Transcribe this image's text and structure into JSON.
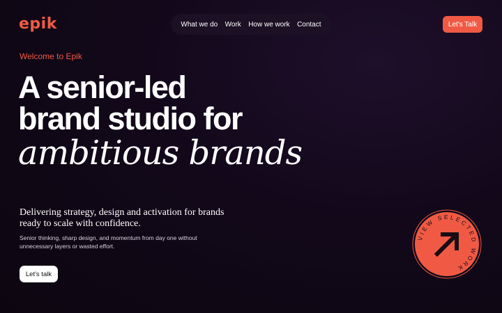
{
  "brand": {
    "logo_text": "epik",
    "accent": "#f05a44"
  },
  "nav": {
    "items": [
      {
        "label": "What we do"
      },
      {
        "label": "Work"
      },
      {
        "label": "How we work"
      },
      {
        "label": "Contact"
      }
    ]
  },
  "header": {
    "cta_label": "Let's Talk"
  },
  "hero": {
    "eyebrow": "Welcome to Epik",
    "headline_line1": "A senior-led",
    "headline_line2": "brand studio for",
    "headline_line3": "ambitious brands",
    "subhead": "Delivering strategy, design and activation for brands ready to scale with confidence.",
    "body": "Senior thinking, sharp design, and momentum from day one without unnecessary layers or wasted effort.",
    "cta_label": "Let's talk"
  },
  "badge": {
    "ring_text": "VIEW SELECTED WORK",
    "icon": "arrow-up-right-icon"
  }
}
